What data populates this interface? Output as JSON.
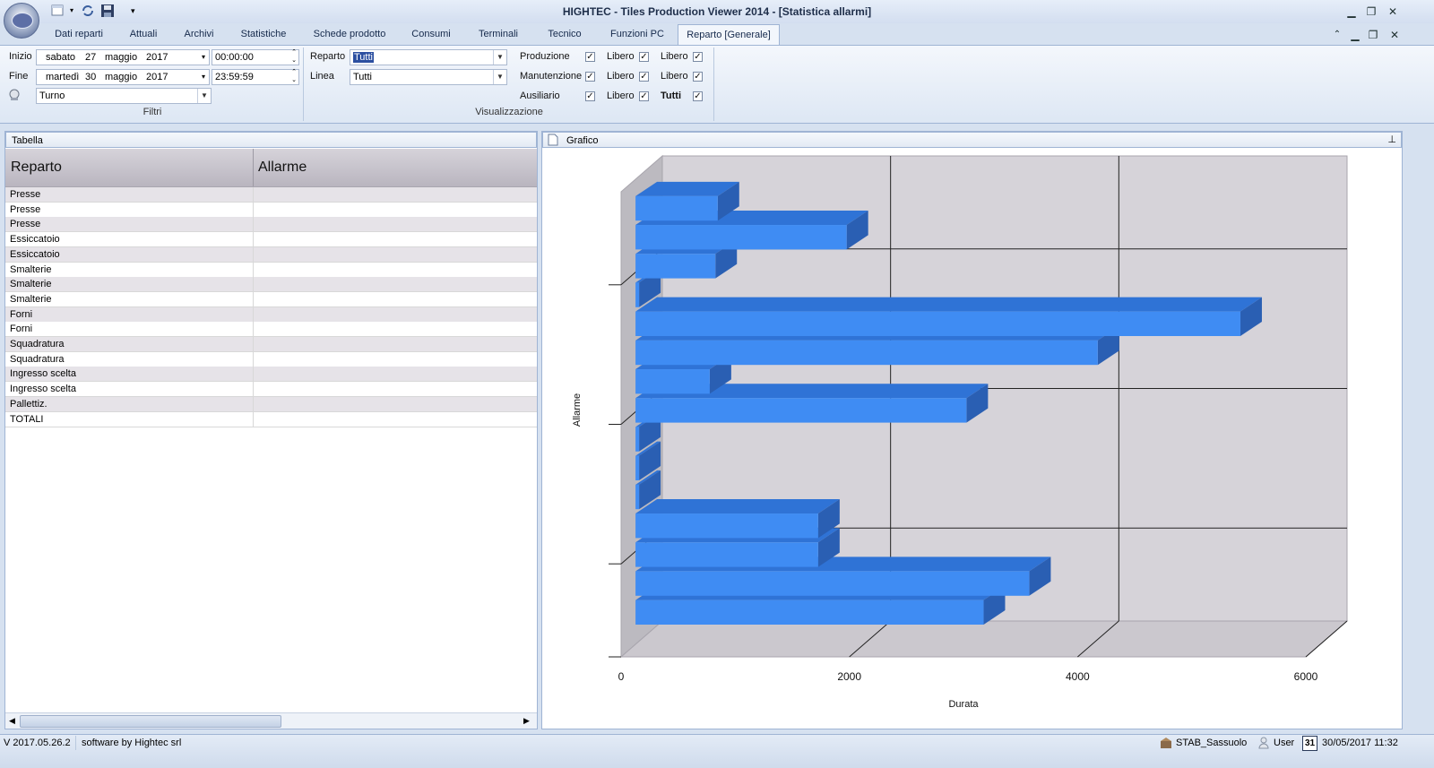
{
  "window": {
    "title": "HIGHTEC - Tiles Production Viewer 2014 - [Statistica allarmi]",
    "controls": [
      "minimize-icon",
      "restore-icon",
      "close-icon"
    ]
  },
  "ribbon_tabs": [
    "Dati reparti",
    "Attuali",
    "Archivi",
    "Statistiche",
    "Schede prodotto",
    "Consumi",
    "Terminali",
    "Tecnico",
    "Funzioni PC",
    "Reparto [Generale]"
  ],
  "active_tab": "Reparto [Generale]",
  "filters": {
    "inizio_label": "Inizio",
    "inizio_weekday": "sabato",
    "inizio_day": "27",
    "inizio_month": "maggio",
    "inizio_year": "2017",
    "inizio_time": "00:00:00",
    "fine_label": "Fine",
    "fine_weekday": "martedì",
    "fine_day": "30",
    "fine_month": "maggio",
    "fine_year": "2017",
    "fine_time": "23:59:59",
    "shift_value": "Turno",
    "group_label": "Filtri"
  },
  "view": {
    "reparto_label": "Reparto",
    "reparto_value": "Tutti",
    "linea_label": "Linea",
    "linea_value": "Tutti",
    "checks": [
      {
        "label": "Produzione",
        "checked": true
      },
      {
        "label": "Libero",
        "checked": true
      },
      {
        "label": "Libero",
        "checked": true
      },
      {
        "label": "Manutenzione",
        "checked": true
      },
      {
        "label": "Libero",
        "checked": true
      },
      {
        "label": "Libero",
        "checked": true
      },
      {
        "label": "Ausiliario",
        "checked": true
      },
      {
        "label": "Libero",
        "checked": true
      },
      {
        "label": "Tutti",
        "checked": true
      }
    ],
    "group_label": "Visualizzazione"
  },
  "table": {
    "title": "Tabella",
    "columns": [
      "Reparto",
      "Allarme"
    ],
    "rows": [
      "Presse",
      "Presse",
      "Presse",
      "Essiccatoio",
      "Essiccatoio",
      "Smalterie",
      "Smalterie",
      "Smalterie",
      "Forni",
      "Forni",
      "Squadratura",
      "Squadratura",
      "Ingresso scelta",
      "Ingresso scelta",
      "Pallettiz.",
      "TOTALI"
    ]
  },
  "chart_panel": {
    "title": "Grafico"
  },
  "chart_data": {
    "type": "bar",
    "orientation": "horizontal",
    "xlabel": "Durata",
    "ylabel": "Allarme",
    "xlim": [
      0,
      6000
    ],
    "x_ticks": [
      "0",
      "2000",
      "4000",
      "6000"
    ],
    "grid": true,
    "values": [
      3050,
      3450,
      1600,
      1600,
      0,
      0,
      0,
      2900,
      650,
      4050,
      5300,
      0,
      700,
      1850,
      720
    ]
  },
  "status": {
    "version": "V 2017.05.26.2",
    "credit": "software by Hightec srl",
    "station": "STAB_Sassuolo",
    "user": "User",
    "calendar_day": "31",
    "datetime": "30/05/2017 11:32"
  }
}
